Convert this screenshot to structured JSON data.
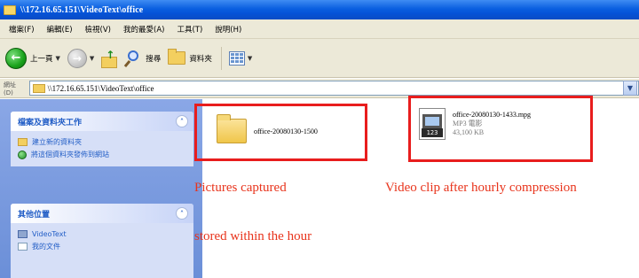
{
  "window": {
    "title": "\\\\172.16.65.151\\VideoText\\office"
  },
  "menu": {
    "items": [
      "檔案(F)",
      "編輯(E)",
      "檢視(V)",
      "我的最愛(A)",
      "工具(T)",
      "說明(H)"
    ]
  },
  "toolbar": {
    "back_label": "上一頁",
    "search_label": "搜尋",
    "folders_label": "資料夾"
  },
  "address": {
    "label": "網址(D)",
    "value": "\\\\172.16.65.151\\VideoText\\office"
  },
  "left_panel": {
    "tasks_header": "檔案及資料夾工作",
    "tasks": [
      "建立新的資料夾",
      "將這個資料夾發佈到網站"
    ],
    "other_header": "其他位置",
    "other_places": [
      "VideoText",
      "我的文件"
    ]
  },
  "files": {
    "folder_name": "office-20080130-1500",
    "video_name": "office-20080130-1433.mpg",
    "video_type": "MP3 電影",
    "video_size": "43,100 KB",
    "video_badge": "123"
  },
  "annotations": {
    "pictures_line1": "Pictures captured",
    "pictures_line2": "stored within the hour",
    "video": "Video clip after hourly compression"
  },
  "colors": {
    "annotation_red": "#e8341c",
    "box_red": "#e81d1d",
    "titlebar_blue": "#0552d6",
    "task_link_blue": "#215dc6"
  }
}
